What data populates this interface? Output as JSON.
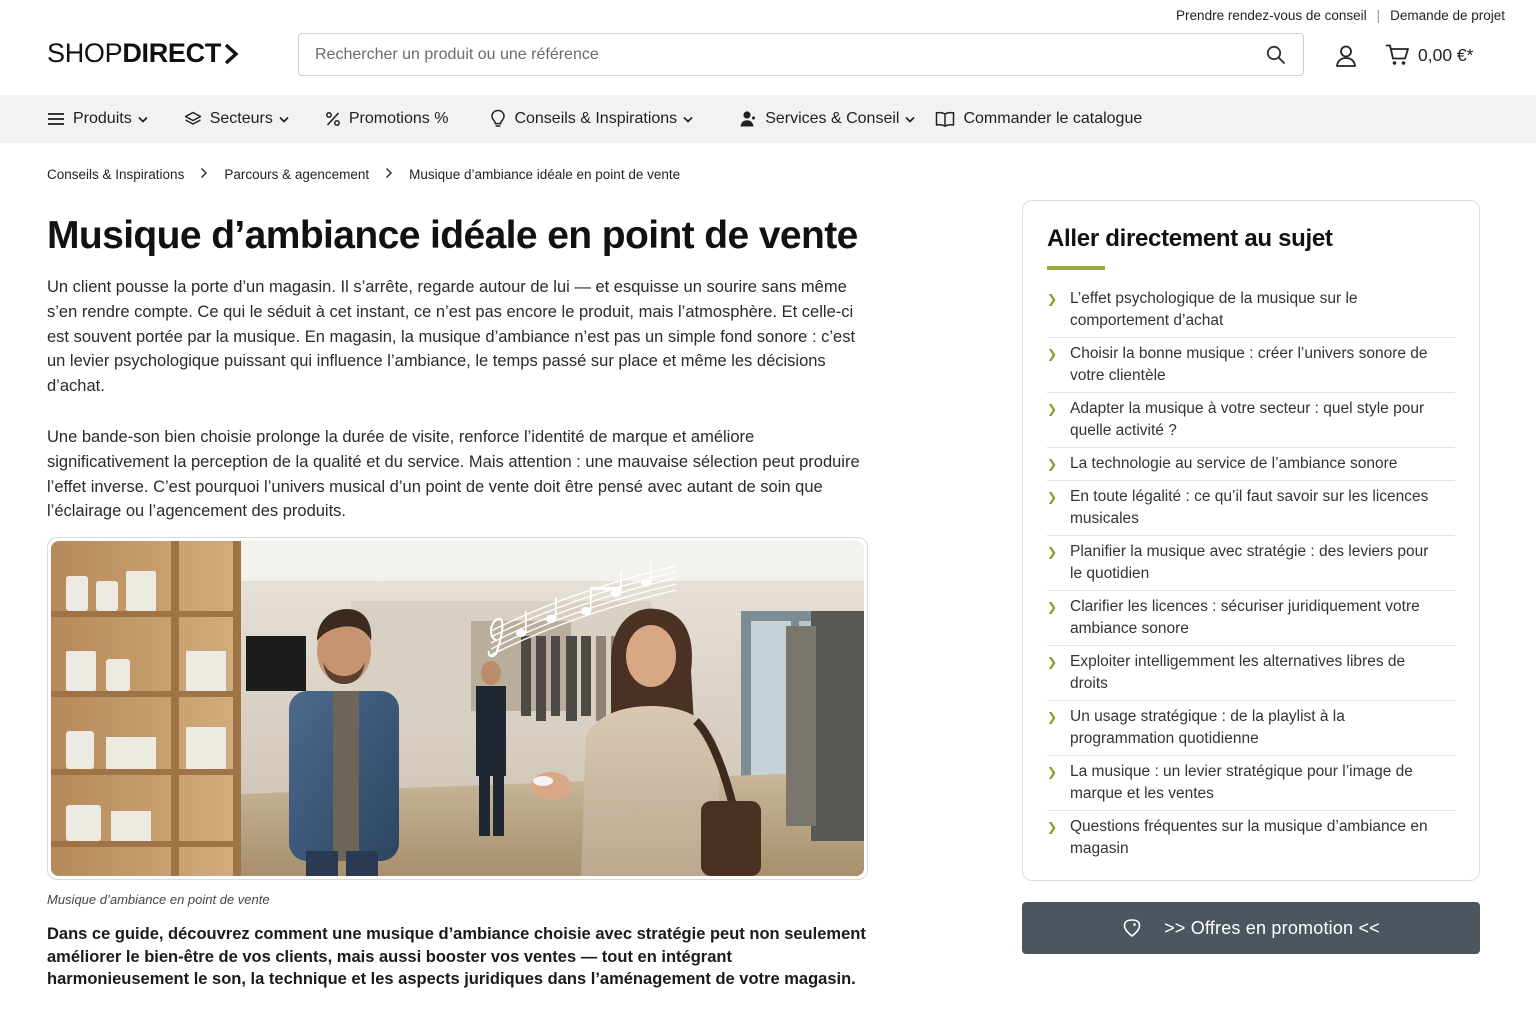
{
  "utility": {
    "appointment": "Prendre rendez-vous de conseil",
    "separator": "|",
    "project": "Demande de projet"
  },
  "header": {
    "logo_light": "SHOP",
    "logo_bold": "DIRECT",
    "search_placeholder": "Rechercher un produit ou une référence",
    "cart_total": "0,00 €*"
  },
  "nav": {
    "items": [
      {
        "label": "Produits",
        "icon": "menu-icon",
        "dropdown": true
      },
      {
        "label": "Secteurs",
        "icon": "layers-icon",
        "dropdown": true
      },
      {
        "label": "Promotions %",
        "icon": "percent-icon",
        "dropdown": false
      },
      {
        "label": "Conseils & Inspirations",
        "icon": "lightbulb-icon",
        "dropdown": true
      },
      {
        "label": "Services & Conseil",
        "icon": "person-icon",
        "dropdown": true
      },
      {
        "label": "Commander le catalogue",
        "icon": "book-icon",
        "dropdown": false
      }
    ]
  },
  "breadcrumb": [
    "Conseils & Inspirations",
    "Parcours & agencement",
    "Musique d’ambiance idéale en point de vente"
  ],
  "article": {
    "title": "Musique d’ambiance idéale en point de vente",
    "paragraph1": "Un client pousse la porte d’un magasin. Il s’arrête, regarde autour de lui — et esquisse un sourire sans même s’en rendre compte. Ce qui le séduit à cet instant, ce n’est pas encore le produit, mais l’atmosphère. Et celle-ci est souvent portée par la musique. En magasin, la musique d’ambiance n’est pas un simple fond sonore : c’est un levier psychologique puissant qui influence l’ambiance, le temps passé sur place et même les décisions d’achat.",
    "paragraph2": "Une bande-son bien choisie prolonge la durée de visite, renforce l’identité de marque et améliore significativement la perception de la qualité et du service. Mais attention : une mauvaise sélection peut produire l’effet inverse. C’est pourquoi l’univers musical d’un point de vente doit être pensé avec autant de soin que l’éclairage ou l’agencement des produits.",
    "image_caption": "Musique d’ambiance en point de vente",
    "intro": "Dans ce guide, découvrez comment une musique d’ambiance choisie avec stratégie peut non seulement améliorer le bien-être de vos clients, mais aussi booster vos ventes — tout en intégrant harmonieusement le son, la technique et les aspects juridiques dans l’aménagement de votre magasin."
  },
  "toc": {
    "title": "Aller directement au sujet",
    "accent_color": "#9caa3a",
    "items": [
      "L’effet psychologique de la musique sur le comportement d’achat",
      "Choisir la bonne musique : créer l’univers sonore de votre clientèle",
      "Adapter la musique à votre secteur : quel style pour quelle activité ?",
      "La technologie au service de l’ambiance sonore",
      "En toute légalité : ce qu’il faut savoir sur les licences musicales",
      "Planifier la musique avec stratégie : des leviers pour le quotidien",
      "Clarifier les licences : sécuriser juridiquement votre ambiance sonore",
      "Exploiter intelligemment les alternatives libres de droits",
      "Un usage stratégique : de la playlist à la programmation quotidienne",
      "La musique : un levier stratégique pour l’image de marque et les ventes",
      "Questions fréquentes sur la musique d’ambiance en magasin"
    ]
  },
  "promo": {
    "label": ">> Offres en promotion <<",
    "background": "#4c5560"
  }
}
